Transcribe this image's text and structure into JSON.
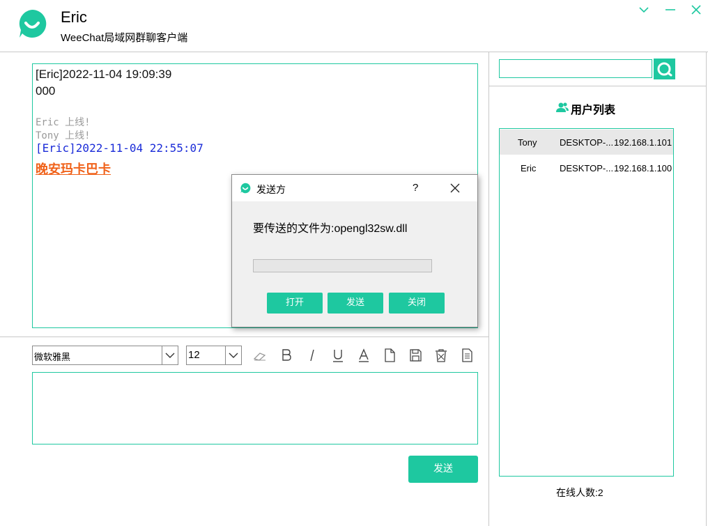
{
  "header": {
    "user_name": "Eric",
    "subtitle": "WeeChat局域网群聊客户端"
  },
  "colors": {
    "accent": "#1ec8a0",
    "message_blue": "#1a2bd8",
    "message_orange": "#f0621a",
    "system_gray": "#9a9a9a"
  },
  "window_controls": [
    {
      "name": "chevron-down-icon"
    },
    {
      "name": "minimize-icon"
    },
    {
      "name": "close-icon"
    }
  ],
  "chat": {
    "messages": [
      {
        "type": "header",
        "text": "[Eric]2022-11-04 19:09:39"
      },
      {
        "type": "body",
        "text": "000"
      },
      {
        "type": "system",
        "text": "Eric 上线!"
      },
      {
        "type": "system",
        "text": "Tony 上线!"
      },
      {
        "type": "header-blue",
        "text": "[Eric]2022-11-04 22:55:07"
      },
      {
        "type": "body-orange",
        "text": "晚安玛卡巴卡"
      }
    ]
  },
  "toolbar": {
    "font_family_value": "微软雅黑",
    "font_size_value": "12",
    "tools": [
      "eraser-icon",
      "bold-icon",
      "italic-icon",
      "underline-icon",
      "text-color-icon",
      "file-icon",
      "save-icon",
      "trash-icon",
      "document-icon"
    ]
  },
  "input": {
    "value": ""
  },
  "send_button": {
    "label": "发送"
  },
  "search": {
    "value": ""
  },
  "user_list": {
    "title": "用户列表",
    "rows": [
      {
        "name": "Tony",
        "host": "DESKTOP-...",
        "ip": "192.168.1.101",
        "selected": true
      },
      {
        "name": "Eric",
        "host": "DESKTOP-...",
        "ip": "192.168.1.100",
        "selected": false
      }
    ],
    "online_label": "在线人数:2"
  },
  "dialog": {
    "title": "发送方",
    "help": "?",
    "message": "要传送的文件为:opengl32sw.dll",
    "progress": 0,
    "buttons": {
      "open": "打开",
      "send": "发送",
      "close": "关闭"
    }
  }
}
